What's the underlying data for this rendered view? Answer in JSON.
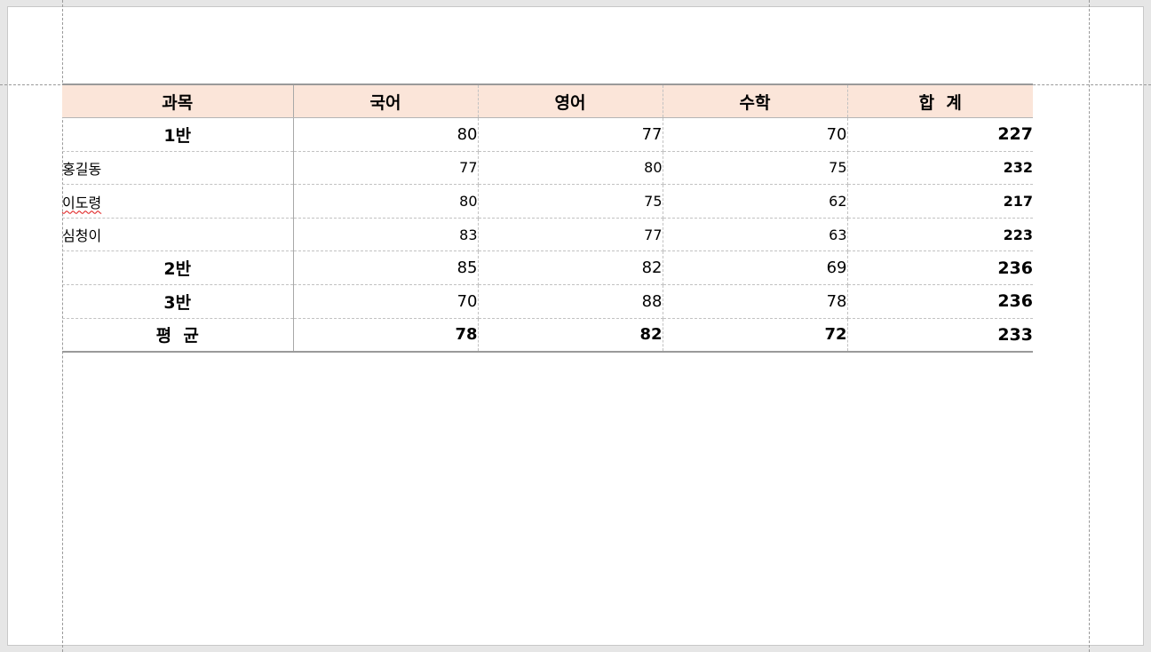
{
  "table": {
    "headers": [
      "과목",
      "국어",
      "영어",
      "수학",
      "합  계"
    ],
    "rows": [
      {
        "label": "1반",
        "korean": "80",
        "english": "77",
        "math": "70",
        "total": "227"
      },
      {
        "label": "홍길동",
        "korean": "77",
        "english": "80",
        "math": "75",
        "total": "232"
      },
      {
        "label": "이도령",
        "korean": "80",
        "english": "75",
        "math": "62",
        "total": "217"
      },
      {
        "label": "심청이",
        "korean": "83",
        "english": "77",
        "math": "63",
        "total": "223"
      },
      {
        "label": "2반",
        "korean": "85",
        "english": "82",
        "math": "69",
        "total": "236"
      },
      {
        "label": "3반",
        "korean": "70",
        "english": "88",
        "math": "78",
        "total": "236"
      },
      {
        "label": "평  균",
        "korean": "78",
        "english": "82",
        "math": "72",
        "total": "233"
      }
    ]
  },
  "colors": {
    "header_fill": "#fbe5d9",
    "spellcheck_underline": "#dd1111"
  }
}
